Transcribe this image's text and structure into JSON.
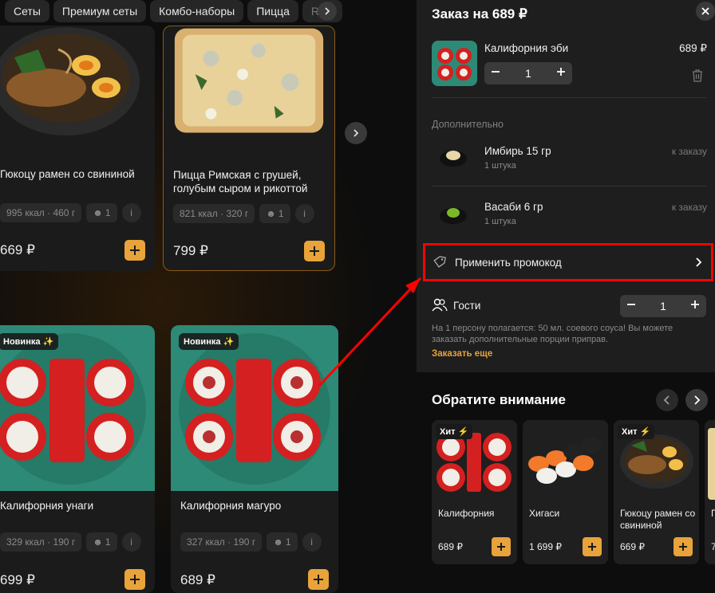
{
  "tabs": [
    "Сеты",
    "Премиум сеты",
    "Комбо-наборы",
    "Пицца",
    "Raw"
  ],
  "menu": {
    "cards": [
      {
        "name": "Гюкоцу рамен со свининой",
        "kcal": "995 ккал · 460 г",
        "persons": "1",
        "price": "669 ₽"
      },
      {
        "name": "Пицца Римская с грушей, голубым сыром и рикоттой",
        "kcal": "821 ккал · 320 г",
        "persons": "1",
        "price": "799 ₽"
      },
      {
        "name": "Калифорния унаги",
        "kcal": "329 ккал · 190 г",
        "persons": "1",
        "price": "699 ₽",
        "badge": "Новинка ✨"
      },
      {
        "name": "Калифорния магуро",
        "kcal": "327 ккал · 190 г",
        "persons": "1",
        "price": "689 ₽",
        "badge": "Новинка ✨"
      }
    ]
  },
  "cart": {
    "title": "Заказ на 689 ₽",
    "item": {
      "name": "Калифорния эби",
      "price": "689 ₽",
      "qty": "1"
    },
    "extras_label": "Дополнительно",
    "extras": [
      {
        "name": "Имбирь 15 гр",
        "sub": "1 штука",
        "note": "к заказу"
      },
      {
        "name": "Васаби 6 гр",
        "sub": "1 штука",
        "note": "к заказу"
      }
    ],
    "promo_label": "Применить промокод",
    "guests_label": "Гости",
    "guests_qty": "1",
    "note": "На 1 персону полагается: 50 мл. соевого соуса! Вы можете заказать дополнительные порции приправ.",
    "more_link": "Заказать еще"
  },
  "recommend": {
    "title": "Обратите внимание",
    "items": [
      {
        "name": "Калифорния",
        "price": "689 ₽",
        "badge": "Хит ⚡"
      },
      {
        "name": "Хигаси",
        "price": "1 699 ₽"
      },
      {
        "name": "Гюкоцу рамен со свининой",
        "price": "669 ₽",
        "badge": "Хит ⚡"
      },
      {
        "name": "П",
        "price": "7"
      }
    ]
  },
  "colors": {
    "accent": "#e8a33a",
    "highlight": "#ff0000",
    "teal": "#2d8a76"
  }
}
